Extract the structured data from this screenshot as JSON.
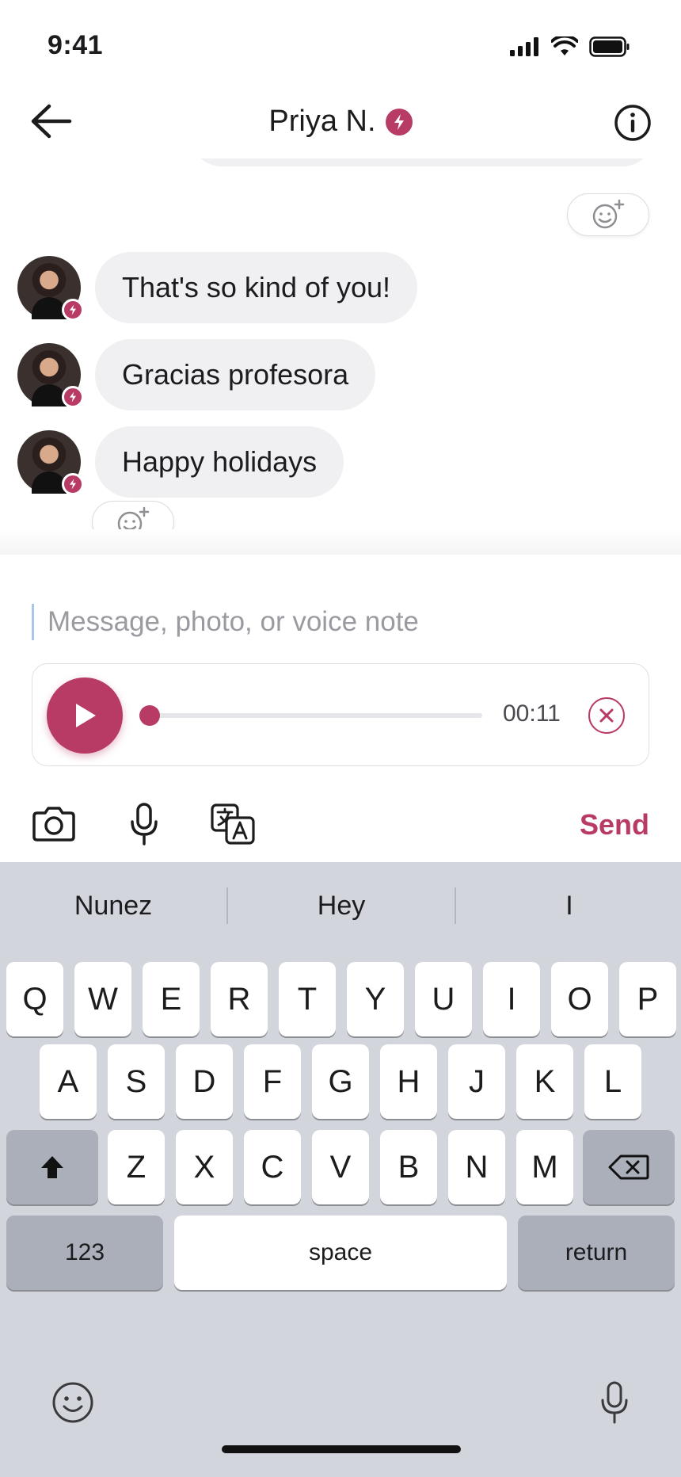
{
  "status_bar": {
    "time": "9:41",
    "icons": [
      "cellular-signal-icon",
      "wifi-icon",
      "battery-icon"
    ]
  },
  "nav": {
    "title": "Priya N.",
    "back_icon": "arrow-left-icon",
    "info_icon": "info-icon",
    "verified_icon": "lightning-badge-icon"
  },
  "messages": [
    {
      "text": "That's so kind of you!"
    },
    {
      "text": "Gracias profesora"
    },
    {
      "text": "Happy holidays"
    }
  ],
  "composer": {
    "placeholder": "Message, photo, or voice note",
    "voice_note": {
      "duration": "00:11",
      "progress": 0.0
    },
    "tools": [
      "camera-icon",
      "microphone-icon",
      "translate-icon"
    ],
    "send_label": "Send"
  },
  "keyboard": {
    "suggestions": [
      "Nunez",
      "Hey",
      "I"
    ],
    "rows": [
      [
        "Q",
        "W",
        "E",
        "R",
        "T",
        "Y",
        "U",
        "I",
        "O",
        "P"
      ],
      [
        "A",
        "S",
        "D",
        "F",
        "G",
        "H",
        "J",
        "K",
        "L"
      ],
      [
        "Z",
        "X",
        "C",
        "V",
        "B",
        "N",
        "M"
      ]
    ],
    "numbers_label": "123",
    "space_label": "space",
    "return_label": "return"
  },
  "colors": {
    "accent": "#b83b65",
    "bubble": "#f0f0f2",
    "keyboard_bg": "#d3d5dc"
  }
}
